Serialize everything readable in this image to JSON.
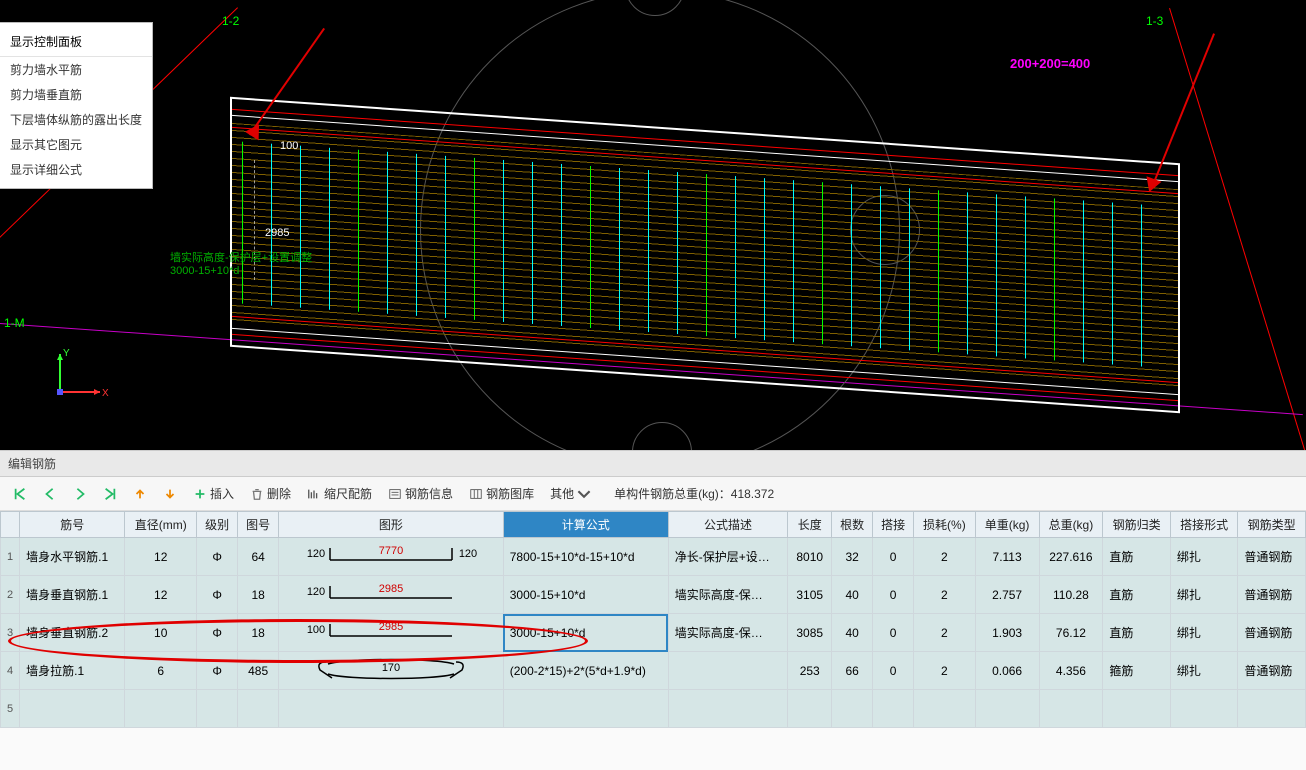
{
  "viewport": {
    "panel_title": "显示控制面板",
    "panel_items": [
      "剪力墙水平筋",
      "剪力墙垂直筋",
      "下层墙体纵筋的露出长度",
      "显示其它图元",
      "显示详细公式"
    ],
    "grid_labels": {
      "left": "1-2",
      "right": "1-3",
      "side": "1-M"
    },
    "magenta_note": "200+200=400",
    "green_note_line1": "墙实际高度-保护层+设置调整",
    "green_note_line2": "3000-15+10*d",
    "dim_100": "100",
    "dim_2985": "2985",
    "axis": {
      "x": "X",
      "y": "Y"
    }
  },
  "bottom": {
    "tab": "编辑钢筋",
    "toolbar": {
      "insert": "插入",
      "delete": "删除",
      "scale": "缩尺配筋",
      "info": "钢筋信息",
      "lib": "钢筋图库",
      "other": "其他"
    },
    "total_label": "单构件钢筋总重(kg)：",
    "total_value": "418.372",
    "headers": [
      "",
      "筋号",
      "直径(mm)",
      "级别",
      "图号",
      "图形",
      "计算公式",
      "公式描述",
      "长度",
      "根数",
      "搭接",
      "损耗(%)",
      "单重(kg)",
      "总重(kg)",
      "钢筋归类",
      "搭接形式",
      "钢筋类型"
    ],
    "highlight_col": 6,
    "rows": [
      {
        "idx": "1",
        "name": "墙身水平钢筋.1",
        "dia": "12",
        "grade": "Φ",
        "pic": "64",
        "shape": {
          "left": "120",
          "mid": "7770",
          "right": "120",
          "hooks": "both",
          "midred": true
        },
        "formula": "7800-15+10*d-15+10*d",
        "desc": "净长-保护层+设…",
        "len": "8010",
        "count": "32",
        "lap": "0",
        "loss": "2",
        "unit": "7.113",
        "total": "227.616",
        "cat": "直筋",
        "form": "绑扎",
        "type": "普通钢筋"
      },
      {
        "idx": "2",
        "name": "墙身垂直钢筋.1",
        "dia": "12",
        "grade": "Φ",
        "pic": "18",
        "shape": {
          "left": "120",
          "mid": "2985",
          "right": "",
          "hooks": "left",
          "midred": true
        },
        "formula": "3000-15+10*d",
        "desc": "墙实际高度-保…",
        "len": "3105",
        "count": "40",
        "lap": "0",
        "loss": "2",
        "unit": "2.757",
        "total": "110.28",
        "cat": "直筋",
        "form": "绑扎",
        "type": "普通钢筋"
      },
      {
        "idx": "3",
        "name": "墙身垂直钢筋.2",
        "dia": "10",
        "grade": "Φ",
        "pic": "18",
        "shape": {
          "left": "100",
          "mid": "2985",
          "right": "",
          "hooks": "left",
          "midred": true
        },
        "formula": "3000-15+10*d",
        "desc": "墙实际高度-保…",
        "len": "3085",
        "count": "40",
        "lap": "0",
        "loss": "2",
        "unit": "1.903",
        "total": "76.12",
        "cat": "直筋",
        "form": "绑扎",
        "type": "普通钢筋",
        "selected": true
      },
      {
        "idx": "4",
        "name": "墙身拉筋.1",
        "dia": "6",
        "grade": "Φ",
        "pic": "485",
        "shape": {
          "left": "",
          "mid": "170",
          "right": "",
          "hooks": "tie",
          "midred": false
        },
        "formula": "(200-2*15)+2*(5*d+1.9*d)",
        "desc": "",
        "len": "253",
        "count": "66",
        "lap": "0",
        "loss": "2",
        "unit": "0.066",
        "total": "4.356",
        "cat": "箍筋",
        "form": "绑扎",
        "type": "普通钢筋"
      },
      {
        "idx": "5",
        "name": "",
        "dia": "",
        "grade": "",
        "pic": "",
        "shape": null,
        "formula": "",
        "desc": "",
        "len": "",
        "count": "",
        "lap": "",
        "loss": "",
        "unit": "",
        "total": "",
        "cat": "",
        "form": "",
        "type": ""
      }
    ]
  }
}
